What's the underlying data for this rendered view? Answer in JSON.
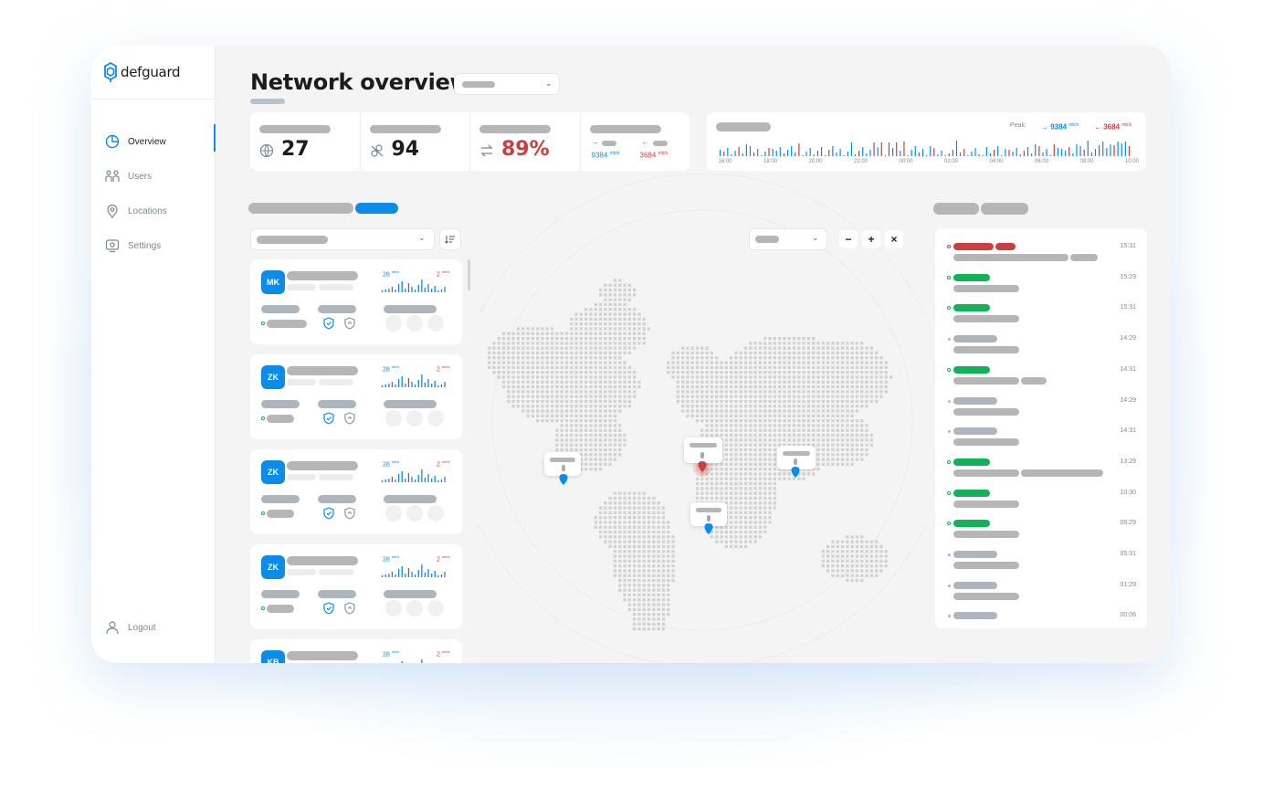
{
  "app": {
    "name": "defguard"
  },
  "sidebar": {
    "items": [
      {
        "label": "Overview",
        "icon": "pie-chart-icon",
        "active": true
      },
      {
        "label": "Users",
        "icon": "users-icon",
        "active": false
      },
      {
        "label": "Locations",
        "icon": "location-pin-icon",
        "active": false
      },
      {
        "label": "Settings",
        "icon": "settings-icon",
        "active": false
      }
    ],
    "logout_label": "Logout"
  },
  "header": {
    "title": "Network overview"
  },
  "stats": {
    "users": {
      "value": "27",
      "icon": "globe-users-icon"
    },
    "devices": {
      "value": "94",
      "icon": "user-link-icon"
    },
    "usage": {
      "value": "89%",
      "icon": "transfer-icon"
    },
    "transfer": {
      "down": {
        "value": "9384",
        "unit": "mb/s",
        "arrow": "→"
      },
      "up": {
        "value": "3684",
        "unit": "mb/s",
        "arrow": "←"
      }
    }
  },
  "traffic_chart": {
    "peak_label": "Peak:",
    "peak_down": "→ 9384",
    "peak_up": "← 3684",
    "unit": "mb/s",
    "ticks": [
      "16:00",
      "18:00",
      "20:00",
      "22:00",
      "00:00",
      "02:00",
      "04:00",
      "06:00",
      "08:00",
      "10:00"
    ],
    "colors": {
      "download": "#0c8ce9",
      "upload": "#cb3f3f"
    }
  },
  "device_cards": [
    {
      "initials": "MK",
      "rate_down": "28",
      "rate_up": "2",
      "unit": "mb/s",
      "status": "online"
    },
    {
      "initials": "ZK",
      "rate_down": "28",
      "rate_up": "2",
      "unit": "mb/s",
      "status": "online"
    },
    {
      "initials": "ZK",
      "rate_down": "28",
      "rate_up": "2",
      "unit": "mb/s",
      "status": "online"
    },
    {
      "initials": "ZK",
      "rate_down": "28",
      "rate_up": "2",
      "unit": "mb/s",
      "status": "online"
    },
    {
      "initials": "KB",
      "rate_down": "28",
      "rate_up": "2",
      "unit": "mb/s",
      "status": "online"
    }
  ],
  "map": {
    "controls": {
      "zoom_out": "−",
      "zoom_in": "+",
      "close": "×"
    },
    "pins": [
      {
        "name": "north-america",
        "color": "#0c8ce9"
      },
      {
        "name": "europe",
        "color": "#cb3f3f"
      },
      {
        "name": "asia",
        "color": "#0c8ce9"
      },
      {
        "name": "africa",
        "color": "#0c8ce9"
      }
    ]
  },
  "activity": {
    "rows": [
      {
        "time": "15:31",
        "status": "error"
      },
      {
        "time": "15:29",
        "status": "success"
      },
      {
        "time": "15:31",
        "status": "success"
      },
      {
        "time": "14:29",
        "status": "neutral"
      },
      {
        "time": "14:31",
        "status": "success"
      },
      {
        "time": "14:29",
        "status": "neutral"
      },
      {
        "time": "14:31",
        "status": "neutral"
      },
      {
        "time": "13:29",
        "status": "success"
      },
      {
        "time": "10:30",
        "status": "success"
      },
      {
        "time": "09:29",
        "status": "success"
      },
      {
        "time": "05:31",
        "status": "neutral"
      },
      {
        "time": "01:29",
        "status": "neutral"
      },
      {
        "time": "00:06",
        "status": "neutral"
      }
    ]
  },
  "colors": {
    "accent": "#0c8ce9",
    "success": "#14b258",
    "danger": "#cb3f3f",
    "placeholder": "#b6b6b6"
  }
}
